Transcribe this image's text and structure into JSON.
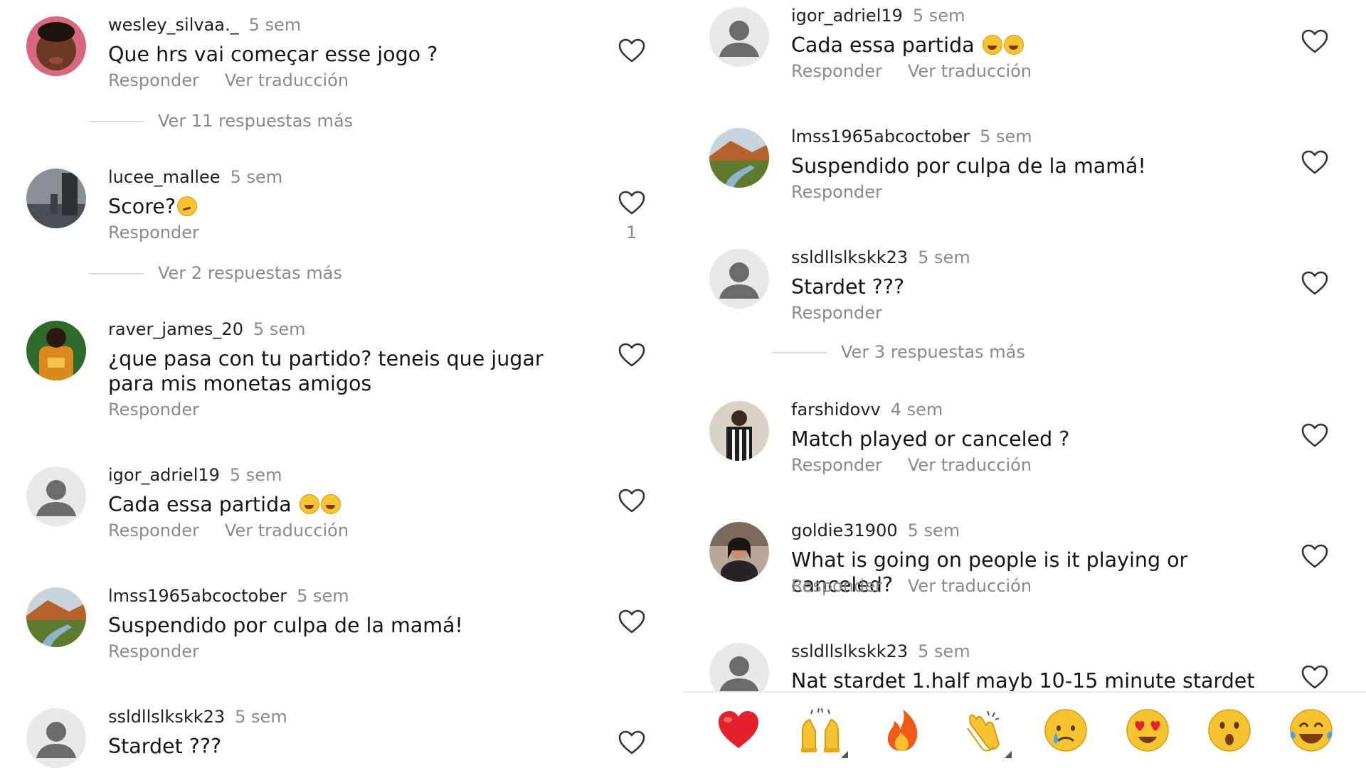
{
  "actions": {
    "reply": "Responder",
    "translate": "Ver traducción"
  },
  "left": {
    "comments": [
      {
        "username": "wesley_silvaa._",
        "time": "5 sem",
        "text": "Que hrs vai começar esse jogo ?"
      },
      {
        "username": "lucee_mallee",
        "time": "5 sem",
        "text": "Score?",
        "likes": "1"
      },
      {
        "username": "raver_james_20",
        "time": "5 sem",
        "text": "¿que pasa con tu partido? teneis que jugar para mis monetas amigos"
      },
      {
        "username": "igor_adriel19",
        "time": "5 sem",
        "text": "Cada essa partida"
      },
      {
        "username": "lmss1965abcoctober",
        "time": "5 sem",
        "text": "Suspendido por culpa de la mamá!"
      },
      {
        "username": "ssldllslkskk23",
        "time": "5 sem",
        "text": "Stardet ???"
      }
    ],
    "replies": [
      "Ver 11 respuestas más",
      "Ver 2 respuestas más"
    ]
  },
  "right": {
    "comments": [
      {
        "username": "igor_adriel19",
        "time": "5 sem",
        "text": "Cada essa partida"
      },
      {
        "username": "lmss1965abcoctober",
        "time": "5 sem",
        "text": "Suspendido por culpa de la mamá!"
      },
      {
        "username": "ssldllslkskk23",
        "time": "5 sem",
        "text": "Stardet ???"
      },
      {
        "username": "farshidovv",
        "time": "4 sem",
        "text": "Match played or canceled ?"
      },
      {
        "username": "goldie31900",
        "time": "5 sem",
        "text": "What is going on people is it playing or canceled?"
      },
      {
        "username": "ssldllslkskk23",
        "time": "5 sem",
        "text": "Nat stardet 1.half mayb 10-15 minute stardet"
      }
    ],
    "replies": [
      "Ver 3 respuestas más"
    ]
  },
  "reactions": [
    "red-heart",
    "raising-hands",
    "fire",
    "clapping-hands",
    "crying-face",
    "heart-eyes-face",
    "surprised-face",
    "tears-of-joy-face"
  ],
  "colors": {
    "secondary_text": "#8a8a8a",
    "heart_red": "#e3202c",
    "emoji_yellow": "#f6c431"
  }
}
